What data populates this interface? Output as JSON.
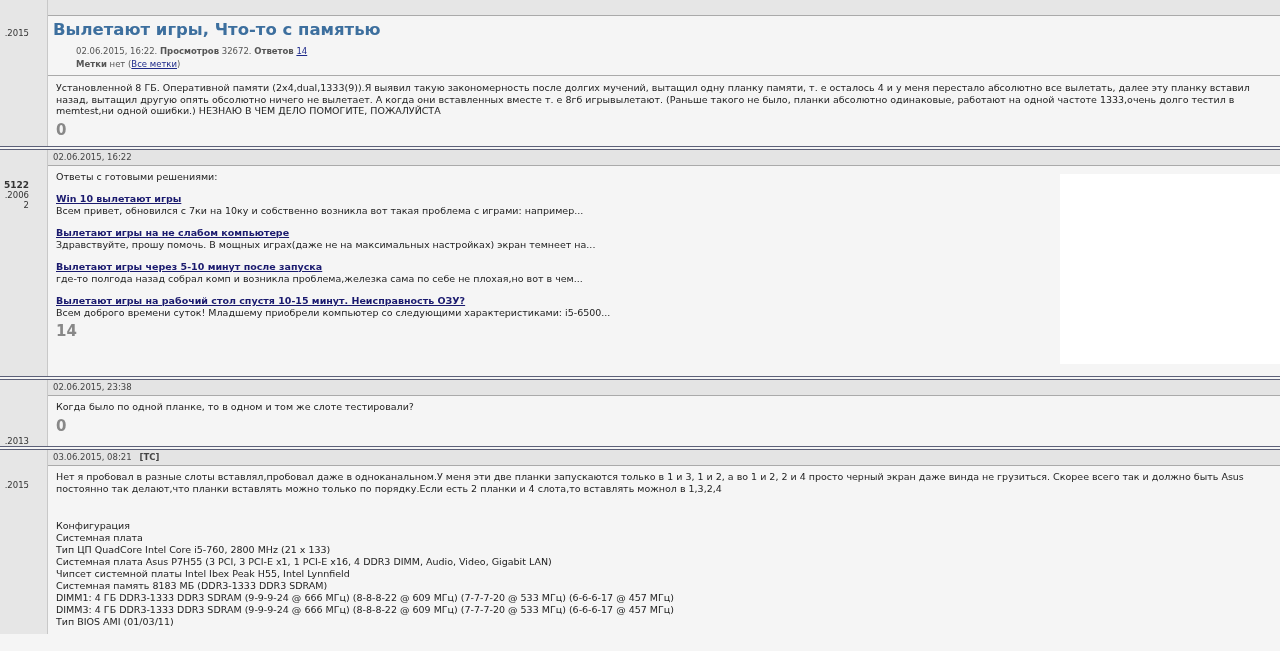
{
  "posts": [
    {
      "kind": "topic",
      "author_info": [
        {
          "text": ".2015",
          "bold": false
        }
      ],
      "title": "Вылетают игры, Что-то с памятью",
      "meta": "02.06.2015, 16:22. **Просмотров** 32672. **Ответов**",
      "meta_link": "14",
      "tags": "**Метки** нет (",
      "tags_link": "Все метки",
      "tags_end": ")",
      "body": [
        "Установленной 8 ГБ. Оперативной памяти (2x4,dual,1333(9)).Я выявил такую закономерность после долгих мучений, вытащил одну планку памяти, т. е осталось 4 и у меня перестало абсолютно все вылетать, далее эту планку вставил назад, вытащил другую опять обсолютно ничего не вылетает. А когда они вставленных вместе т. е 8гб игрывылетают. (Раньше такого не было, планки абсолютно одинаковые, работают на одной частоте 1333,очень долго тестил в memtest,ни одной ошибки.) НЕЗНАЮ В ЧЕМ ДЕЛО ПОМОГИТЕ, ПОЖАЛУЙСТА"
      ],
      "rating": "0"
    },
    {
      "kind": "related",
      "author_info": [
        {
          "text": "5122",
          "bold": true
        },
        {
          "text": ".2006",
          "bold": false
        },
        {
          "text": "2",
          "bold": false
        }
      ],
      "date": "02.06.2015, 16:22",
      "intro": "Ответы с готовыми решениями:",
      "links": [
        {
          "title": "Win 10 вылетают игры",
          "snippet": "Всем привет, обновился с 7ки на 10ку и собственно возникла вот такая проблема с играми: например..."
        },
        {
          "title": "Вылетают игры на не слабом компьютере",
          "snippet": "Здравствуйте, прошу помочь. В мощных играх(даже не на максимальных настройках) экран темнеет на..."
        },
        {
          "title": "Вылетают игры через 5-10 минут после запуска",
          "snippet": "где-то полгода назад собрал комп и возникла проблема,железка сама по себе не плохая,но вот в чем..."
        },
        {
          "title": "Вылетают игры на рабочий стол спустя 10-15 минут. Неисправность ОЗУ?",
          "snippet": "Всем доброго времени суток! Младшему приобрели компьютер со следующими характеристиками: i5-6500..."
        }
      ],
      "rating": "14"
    },
    {
      "kind": "reply",
      "author_info": [
        {
          "text": ".2013",
          "bold": false
        }
      ],
      "date": "02.06.2015, 23:38",
      "body": [
        "Когда было по одной планке, то в одном и том же слоте тестировали?"
      ],
      "rating": "0"
    },
    {
      "kind": "reply",
      "author_info": [
        {
          "text": ".2015",
          "bold": false
        }
      ],
      "date": "03.06.2015, 08:21",
      "tag": "[TC]",
      "body": [
        "Нет я пробовал в разные слоты вставлял,пробовал даже в одноканальном.У меня эти две планки запускаются только в 1 и 3, 1 и 2, а во 1 и 2, 2 и 4 просто черный экран даже винда не грузиться. Скорее всего так и должно быть Asus постоянно так делают,что планки вставлять можно только по порядку.Если есть 2 планки и 4 слота,то вставлять можнол в 1,3,2,4"
      ],
      "lines": [
        "Конфигурация",
        "Системная плата",
        "Тип ЦП QuadCore Intel Core i5-760, 2800 MHz (21 x 133)",
        "Системная плата Asus P7H55 (3 PCI, 3 PCI-E x1, 1 PCI-E x16, 4 DDR3 DIMM, Audio, Video, Gigabit LAN)",
        "Чипсет системной платы Intel Ibex Peak H55, Intel Lynnfield",
        "Системная память 8183 МБ (DDR3-1333 DDR3 SDRAM)",
        "DIMM1: 4 ГБ DDR3-1333 DDR3 SDRAM (9-9-9-24 @ 666 МГц) (8-8-8-22 @ 609 МГц) (7-7-7-20 @ 533 МГц) (6-6-6-17 @ 457 МГц)",
        "DIMM3: 4 ГБ DDR3-1333 DDR3 SDRAM (9-9-9-24 @ 666 МГц) (8-8-8-22 @ 609 МГц) (7-7-7-20 @ 533 МГц) (6-6-6-17 @ 457 МГц)",
        "Тип BIOS AMI (01/03/11)"
      ]
    }
  ]
}
